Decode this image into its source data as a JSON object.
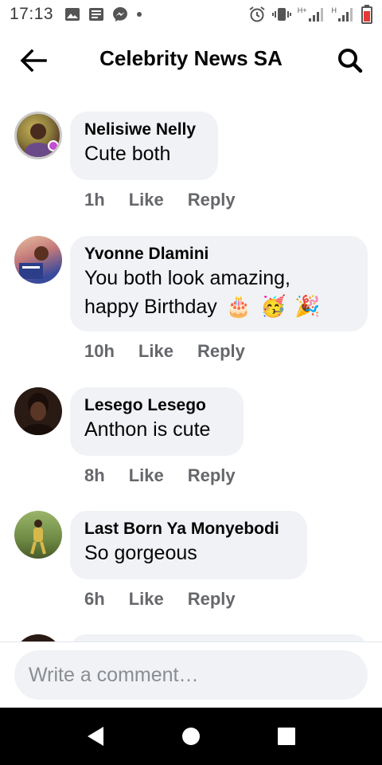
{
  "status_bar": {
    "time": "17:13",
    "left_icons": [
      "gallery-icon",
      "news-icon",
      "messenger-icon",
      "dot-icon"
    ],
    "right_icons": [
      "alarm-icon",
      "vibrate-icon",
      "signal-h-plus-icon",
      "signal-h-icon",
      "battery-low-icon"
    ],
    "network_label_1": "H+",
    "network_label_2": "H"
  },
  "header": {
    "title": "Celebrity News SA",
    "back_icon": "arrow-left-icon",
    "search_icon": "search-icon"
  },
  "comments": [
    {
      "author": "Nelisiwe Nelly",
      "text": "Cute both",
      "time": "1h",
      "like": "Like",
      "reply": "Reply"
    },
    {
      "author": "Yvonne Dlamini",
      "text_line1": "You both look amazing,",
      "text_line2": "happy Birthday",
      "emojis": [
        "🎂",
        "🥳",
        "🎉"
      ],
      "time": "10h",
      "like": "Like",
      "reply": "Reply"
    },
    {
      "author": "Lesego Lesego",
      "text": "Anthon is cute",
      "time": "8h",
      "like": "Like",
      "reply": "Reply"
    },
    {
      "author": "Last Born Ya Monyebodi",
      "text": "So gorgeous",
      "time": "6h",
      "like": "Like",
      "reply": "Reply"
    }
  ],
  "composer": {
    "placeholder": "Write a comment…"
  },
  "nav_bar": {
    "back": "nav-back-icon",
    "home": "nav-home-icon",
    "recents": "nav-recents-icon"
  },
  "colors": {
    "bubble": "#f0f2f5",
    "meta_text": "#65676b",
    "placeholder": "#8a8d91",
    "battery": "#e53935"
  }
}
